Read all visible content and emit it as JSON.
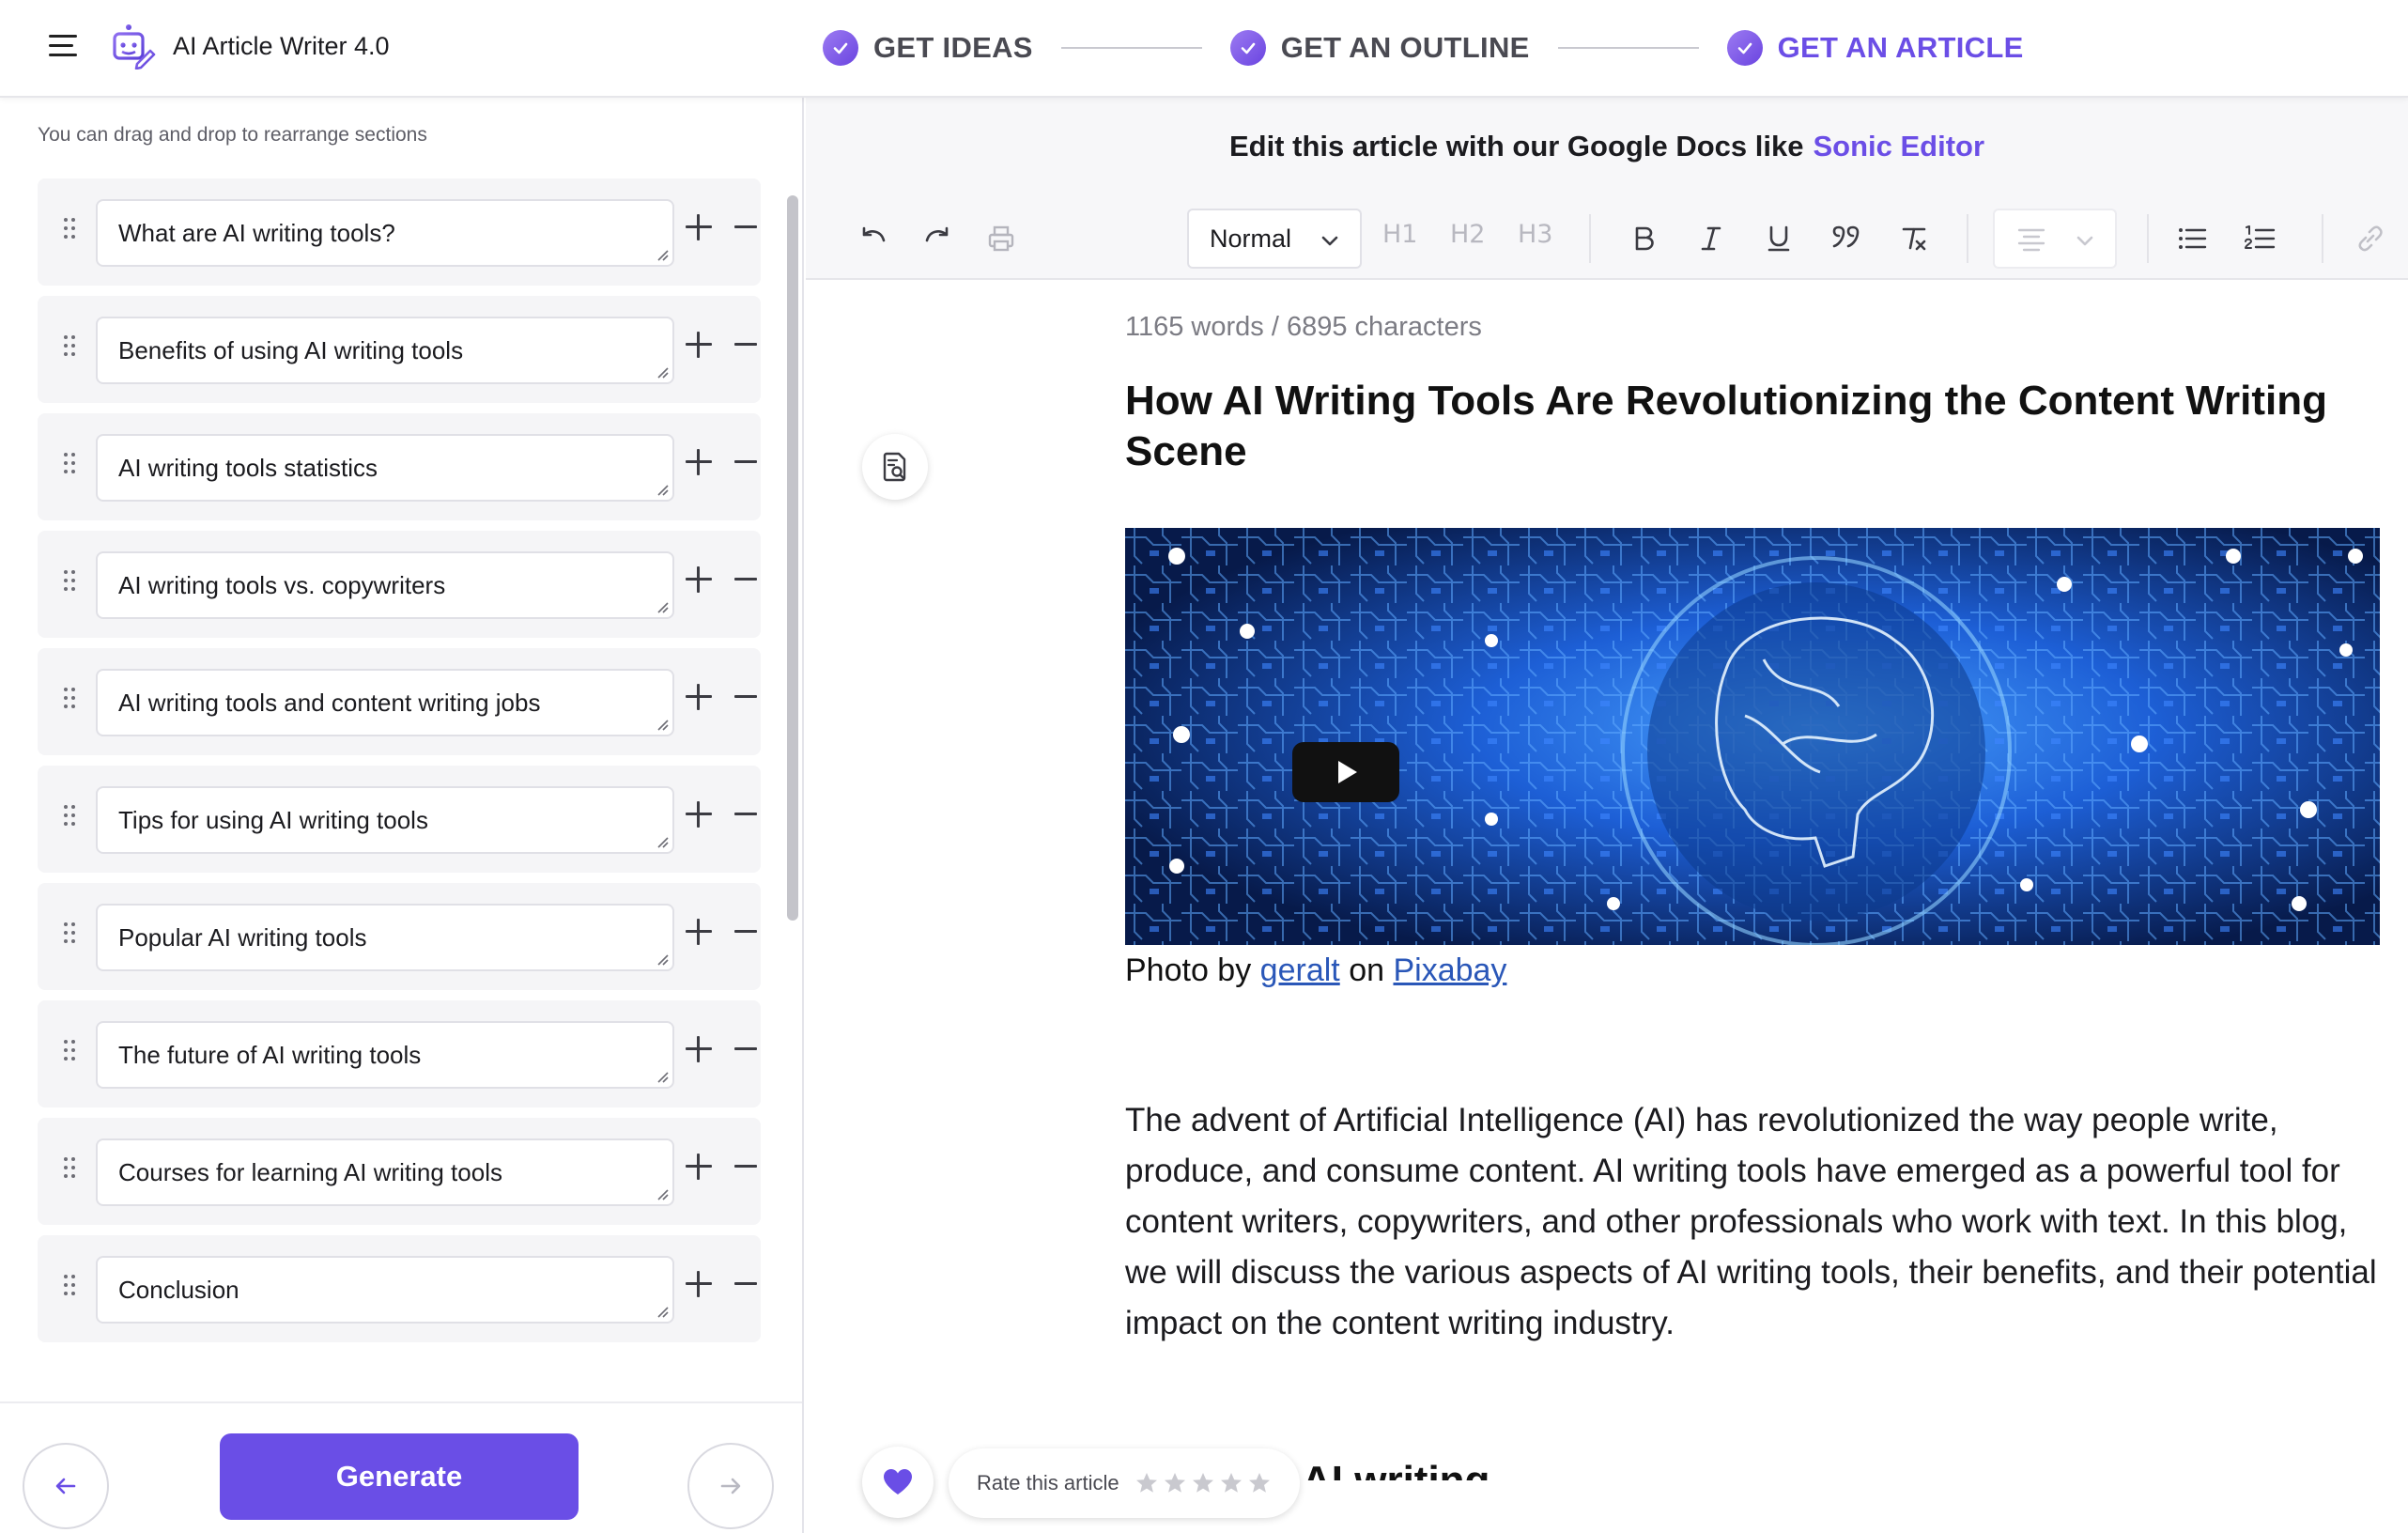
{
  "app": {
    "title": "AI Article Writer 4.0"
  },
  "steps": [
    {
      "label": "GET IDEAS"
    },
    {
      "label": "GET AN OUTLINE"
    },
    {
      "label": "GET AN ARTICLE"
    }
  ],
  "outline": {
    "hint": "You can drag and drop to rearrange sections",
    "sections": [
      "What are AI writing tools?",
      "Benefits of using AI writing tools",
      "AI writing tools statistics",
      "AI writing tools vs. copywriters",
      "AI writing tools and content writing jobs",
      "Tips for using AI writing tools",
      "Popular AI writing tools",
      "The future of AI writing tools",
      "Courses for learning AI writing tools",
      "Conclusion"
    ],
    "generate_label": "Generate"
  },
  "editor": {
    "banner_text": "Edit this article with our Google Docs like",
    "banner_link": "Sonic Editor",
    "style_select": "Normal",
    "headings": [
      "H1",
      "H2",
      "H3"
    ],
    "counts": "1165 words / 6895 characters",
    "title": "How AI Writing Tools Are Revolutionizing the Content Writing Scene",
    "caption": {
      "prefix": "Photo by",
      "author": "geralt",
      "middle": "on",
      "source": "Pixabay"
    },
    "paragraph": "The advent of Artificial Intelligence (AI) has revolutionized the way people write, produce, and consume content. AI writing tools have emerged as a powerful tool for content writers, copywriters, and other professionals who work with text. In this blog, we will discuss the various aspects of AI writing tools, their benefits, and their potential impact on the content writing industry.",
    "next_heading": "AI writing tools?"
  },
  "rating": {
    "label": "Rate this article",
    "stars": 5,
    "value": 0
  },
  "colors": {
    "accent": "#6a4ee6",
    "link": "#2a57b8"
  }
}
